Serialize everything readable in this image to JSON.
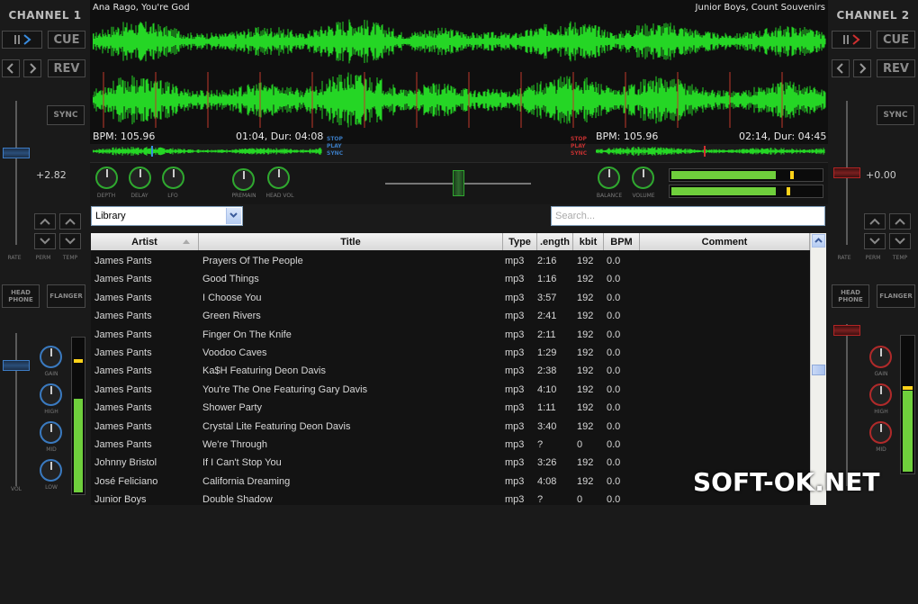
{
  "channel1": {
    "label": "CHANNEL 1",
    "cue_label": "CUE",
    "rev_label": "REV",
    "sync_label": "SYNC",
    "pitch": "+2.82",
    "rate_lbl": "RATE",
    "perm_lbl": "PERM",
    "temp_lbl": "TEMP",
    "headphone_label": "HEAD PHONE",
    "flanger_label": "FLANGER",
    "knobs": [
      "GAIN",
      "HIGH",
      "MID",
      "LOW"
    ],
    "vol_lbl": "VOL",
    "track_title": "Ana Rago, You're God",
    "bpm": "BPM: 105.96",
    "time": "01:04, Dur: 04:08",
    "accent": "#3a8de0"
  },
  "channel2": {
    "label": "CHANNEL 2",
    "cue_label": "CUE",
    "rev_label": "REV",
    "sync_label": "SYNC",
    "pitch": "+0.00",
    "rate_lbl": "RATE",
    "perm_lbl": "PERM",
    "temp_lbl": "TEMP",
    "headphone_label": "HEAD PHONE",
    "flanger_label": "FLANGER",
    "knobs": [
      "GAIN",
      "HIGH",
      "MID",
      "LOW"
    ],
    "track_title": "Junior Boys, Count Souvenirs",
    "bpm": "BPM: 105.96",
    "time": "02:14, Dur: 04:45",
    "accent": "#d03030"
  },
  "effects": {
    "left_knobs": [
      "DEPTH",
      "DELAY",
      "LFO"
    ],
    "pre_knobs": [
      "PREMAIN",
      "HEAD VOL"
    ],
    "right_knobs": [
      "BALANCE",
      "VOLUME"
    ],
    "sync_tags": [
      "STOP",
      "PLAY",
      "SYNC"
    ]
  },
  "library": {
    "source": "Library",
    "search_placeholder": "Search..."
  },
  "table": {
    "headers": {
      "artist": "Artist",
      "title": "Title",
      "type": "Type",
      "length": ".ength",
      "kbit": "kbit",
      "bpm": "BPM",
      "comment": "Comment"
    },
    "rows": [
      {
        "artist": "James Pants",
        "title": "Prayers Of The People",
        "type": "mp3",
        "length": "2:16",
        "kbit": "192",
        "bpm": "0.0"
      },
      {
        "artist": "James Pants",
        "title": "Good Things",
        "type": "mp3",
        "length": "1:16",
        "kbit": "192",
        "bpm": "0.0"
      },
      {
        "artist": "James Pants",
        "title": "I Choose You",
        "type": "mp3",
        "length": "3:57",
        "kbit": "192",
        "bpm": "0.0"
      },
      {
        "artist": "James Pants",
        "title": "Green Rivers",
        "type": "mp3",
        "length": "2:41",
        "kbit": "192",
        "bpm": "0.0"
      },
      {
        "artist": "James Pants",
        "title": "Finger On The Knife",
        "type": "mp3",
        "length": "2:11",
        "kbit": "192",
        "bpm": "0.0"
      },
      {
        "artist": "James Pants",
        "title": "Voodoo Caves",
        "type": "mp3",
        "length": "1:29",
        "kbit": "192",
        "bpm": "0.0"
      },
      {
        "artist": "James Pants",
        "title": "Ka$H Featuring Deon Davis",
        "type": "mp3",
        "length": "2:38",
        "kbit": "192",
        "bpm": "0.0"
      },
      {
        "artist": "James Pants",
        "title": "You're The One Featuring Gary Davis",
        "type": "mp3",
        "length": "4:10",
        "kbit": "192",
        "bpm": "0.0"
      },
      {
        "artist": "James Pants",
        "title": "Shower Party",
        "type": "mp3",
        "length": "1:11",
        "kbit": "192",
        "bpm": "0.0"
      },
      {
        "artist": "James Pants",
        "title": "Crystal Lite Featuring Deon Davis",
        "type": "mp3",
        "length": "3:40",
        "kbit": "192",
        "bpm": "0.0"
      },
      {
        "artist": "James Pants",
        "title": "We're Through",
        "type": "mp3",
        "length": "?",
        "kbit": "0",
        "bpm": "0.0"
      },
      {
        "artist": "Johnny Bristol",
        "title": "If I Can't Stop You",
        "type": "mp3",
        "length": "3:26",
        "kbit": "192",
        "bpm": "0.0"
      },
      {
        "artist": "José Feliciano",
        "title": "California Dreaming",
        "type": "mp3",
        "length": "4:08",
        "kbit": "192",
        "bpm": "0.0"
      },
      {
        "artist": "Junior Boys",
        "title": "Double Shadow",
        "type": "mp3",
        "length": "?",
        "kbit": "0",
        "bpm": "0.0"
      }
    ]
  },
  "watermark": "SOFT-OK.NET",
  "colors": {
    "wave": "#25d625",
    "marker": "#c0392b",
    "vu_fill": "#6fcf3c",
    "vu_peak": "#ffd31a"
  }
}
